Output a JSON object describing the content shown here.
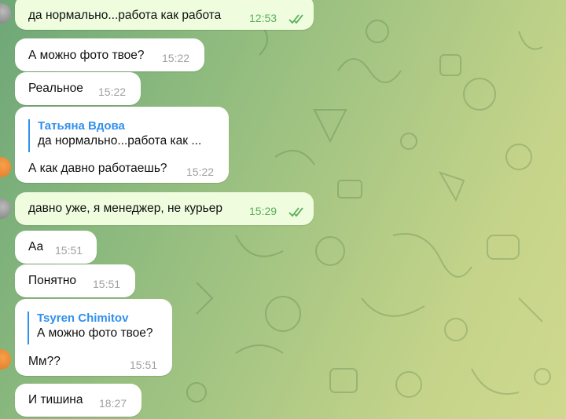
{
  "messages": [
    {
      "text": "да нормально...работа как работа",
      "time": "12:53"
    },
    {
      "text": "А можно фото твое?",
      "time": "15:22"
    },
    {
      "text": "Реальное",
      "time": "15:22"
    },
    {
      "reply_name": "Татьяна Вдова",
      "reply_text": "да нормально...работа как ...",
      "text": "А как давно работаешь?",
      "time": "15:22"
    },
    {
      "text": "давно уже, я менеджер, не курьер",
      "time": "15:29"
    },
    {
      "text": "Аа",
      "time": "15:51"
    },
    {
      "text": "Понятно",
      "time": "15:51"
    },
    {
      "reply_name": "Tsyren Chimitov",
      "reply_text": "А можно фото твое?",
      "text": "Мм??",
      "time": "15:51"
    },
    {
      "text": "И тишина",
      "time": "18:27"
    }
  ],
  "colors": {
    "incoming": "#ffffff",
    "outgoing": "#effdde",
    "accent": "#3390ec",
    "read_check": "#5aae5a"
  },
  "icons": {
    "read_status": "double-check-icon"
  }
}
